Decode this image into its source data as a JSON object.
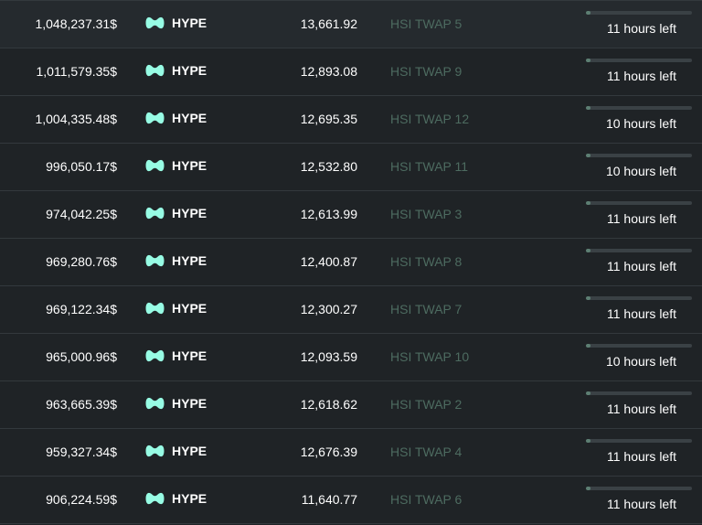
{
  "colors": {
    "background": "#1f2326",
    "divider": "#33393d",
    "link": "#4d6b60",
    "icon_accent": "#97fce4",
    "progress_track": "#3a4145",
    "progress_fill": "#5d7f73"
  },
  "rows": [
    {
      "value": "1,048,237.31$",
      "token": "HYPE",
      "amount": "13,661.92",
      "order": "HSI TWAP 5",
      "time": "11 hours left",
      "progress": 0.04
    },
    {
      "value": "1,011,579.35$",
      "token": "HYPE",
      "amount": "12,893.08",
      "order": "HSI TWAP 9",
      "time": "11 hours left",
      "progress": 0.04
    },
    {
      "value": "1,004,335.48$",
      "token": "HYPE",
      "amount": "12,695.35",
      "order": "HSI TWAP 12",
      "time": "10 hours left",
      "progress": 0.04
    },
    {
      "value": "996,050.17$",
      "token": "HYPE",
      "amount": "12,532.80",
      "order": "HSI TWAP 11",
      "time": "10 hours left",
      "progress": 0.04
    },
    {
      "value": "974,042.25$",
      "token": "HYPE",
      "amount": "12,613.99",
      "order": "HSI TWAP 3",
      "time": "11 hours left",
      "progress": 0.04
    },
    {
      "value": "969,280.76$",
      "token": "HYPE",
      "amount": "12,400.87",
      "order": "HSI TWAP 8",
      "time": "11 hours left",
      "progress": 0.04
    },
    {
      "value": "969,122.34$",
      "token": "HYPE",
      "amount": "12,300.27",
      "order": "HSI TWAP 7",
      "time": "11 hours left",
      "progress": 0.04
    },
    {
      "value": "965,000.96$",
      "token": "HYPE",
      "amount": "12,093.59",
      "order": "HSI TWAP 10",
      "time": "10 hours left",
      "progress": 0.04
    },
    {
      "value": "963,665.39$",
      "token": "HYPE",
      "amount": "12,618.62",
      "order": "HSI TWAP 2",
      "time": "11 hours left",
      "progress": 0.04
    },
    {
      "value": "959,327.34$",
      "token": "HYPE",
      "amount": "12,676.39",
      "order": "HSI TWAP 4",
      "time": "11 hours left",
      "progress": 0.04
    },
    {
      "value": "906,224.59$",
      "token": "HYPE",
      "amount": "11,640.77",
      "order": "HSI TWAP 6",
      "time": "11 hours left",
      "progress": 0.04
    }
  ],
  "icons": {
    "token": "hyperliquid-logo-icon"
  }
}
